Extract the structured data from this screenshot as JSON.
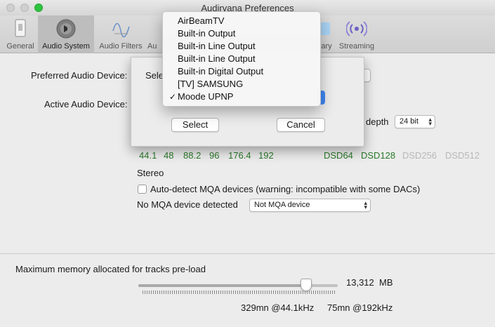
{
  "window": {
    "title": "Audirvana Preferences"
  },
  "toolbar": {
    "items": [
      {
        "label": "General",
        "icon": "switch-icon",
        "active": false
      },
      {
        "label": "Audio System",
        "icon": "speaker-icon",
        "active": true
      },
      {
        "label": "Audio Filters",
        "icon": "filter-icon",
        "active": false
      },
      {
        "label": "Au",
        "icon": "audio-icon",
        "active": false
      },
      {
        "label": "ary",
        "icon": "library-icon",
        "active": false
      },
      {
        "label": "Streaming",
        "icon": "streaming-icon",
        "active": false
      }
    ]
  },
  "audio": {
    "preferred_label": "Preferred Audio Device:",
    "active_label": "Active Audio Device:",
    "bit_depth_label": "depth",
    "bit_depth_value": "24 bit",
    "pcm_rates": [
      "44.1",
      "48",
      "88.2",
      "96",
      "176.4",
      "192"
    ],
    "dsd_supported": [
      "DSD64",
      "DSD128"
    ],
    "dsd_unsupported": [
      "DSD256",
      "DSD512"
    ],
    "channels": "Stereo",
    "mqa_checkbox_label": "Auto-detect MQA devices (warning: incompatible with some DACs)",
    "mqa_status": "No MQA device detected",
    "mqa_select_value": "Not MQA device"
  },
  "memory": {
    "label": "Maximum memory allocated for tracks pre-load",
    "value": "13,312",
    "unit": "MB",
    "slider_fraction": 0.84,
    "at_44k": "329mn @44.1kHz",
    "at_192k": "75mn @192kHz"
  },
  "sheet": {
    "prompt_fragment": "Sele",
    "select_label": "Select",
    "cancel_label": "Cancel"
  },
  "menu": {
    "items": [
      {
        "label": "AirBeamTV",
        "checked": false
      },
      {
        "label": "Built-in Output",
        "checked": false
      },
      {
        "label": "Built-in Line Output",
        "checked": false
      },
      {
        "label": "Built-in Line Output",
        "checked": false
      },
      {
        "label": "Built-in Digital Output",
        "checked": false
      },
      {
        "label": "[TV] SAMSUNG",
        "checked": false
      },
      {
        "label": "Moode UPNP",
        "checked": true
      }
    ],
    "check_glyph": "✓"
  }
}
